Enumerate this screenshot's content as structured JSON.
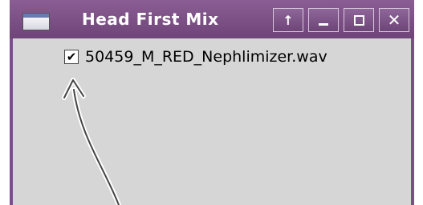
{
  "window": {
    "title": "Head First Mix",
    "icon": "app-window-icon",
    "buttons": {
      "up_glyph": "↑",
      "close_glyph": "✕"
    }
  },
  "files": [
    {
      "name": "50459_M_RED_Nephlimizer.wav",
      "checked": true,
      "check_glyph": "✔"
    }
  ],
  "colors": {
    "titlebar": "#7b4f85",
    "client_background": "#d6d6d6"
  }
}
